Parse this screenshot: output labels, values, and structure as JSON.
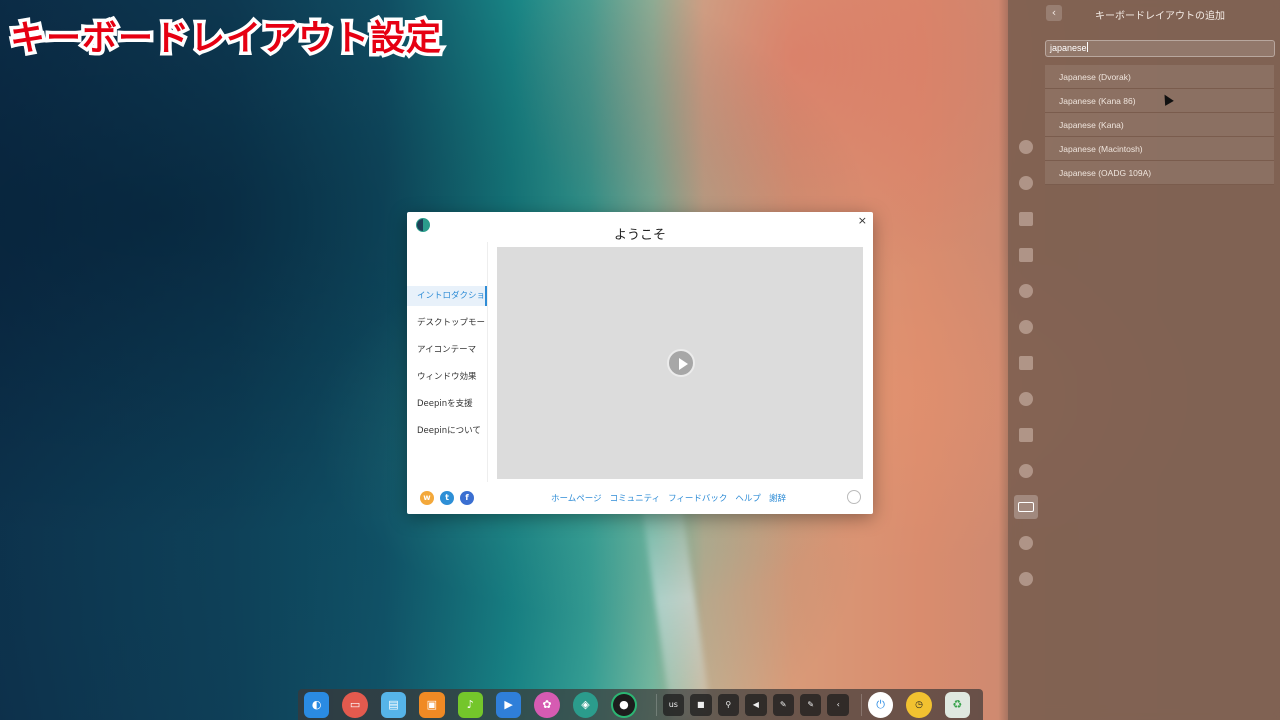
{
  "caption": "キーボードレイアウト設定",
  "panel": {
    "back_icon": "chevron-left-icon",
    "title": "キーボードレイアウトの追加",
    "search_value": "japanese",
    "results": [
      "Japanese (Dvorak)",
      "Japanese (Kana 86)",
      "Japanese (Kana)",
      "Japanese (Macintosh)",
      "Japanese (OADG 109A)"
    ],
    "side_icons": [
      "account-icon",
      "cloud-icon",
      "display-icon",
      "default-apps-icon",
      "personalization-icon",
      "network-icon",
      "sound-icon",
      "time-icon",
      "power-icon",
      "mouse-icon",
      "keyboard-icon",
      "update-icon",
      "info-icon"
    ]
  },
  "dialog": {
    "title": "ようこそ",
    "close": "×",
    "nav": [
      "イントロダクション",
      "デスクトップモード",
      "アイコンテーマ",
      "ウィンドウ効果",
      "Deepinを支援",
      "Deepinについて"
    ],
    "active_nav": 0,
    "links": [
      "ホームページ",
      "コミュニティ",
      "フィードバック",
      "ヘルプ",
      "謝辞"
    ],
    "social": [
      "weibo-icon",
      "twitter-icon",
      "facebook-icon"
    ]
  },
  "dock": {
    "apps": [
      "launcher-icon",
      "multitasking-icon",
      "file-manager-icon",
      "app-store-icon",
      "music-icon",
      "movie-icon",
      "settings-icon",
      "welcome-icon",
      "camera-icon"
    ],
    "tray": [
      "us",
      "screen-record-icon",
      "usb-icon",
      "volume-icon",
      "pen-icon",
      "pen2-icon",
      "collapse-icon"
    ],
    "tray_label": "us",
    "system": [
      "power-icon",
      "clock-icon",
      "trash-icon"
    ]
  }
}
